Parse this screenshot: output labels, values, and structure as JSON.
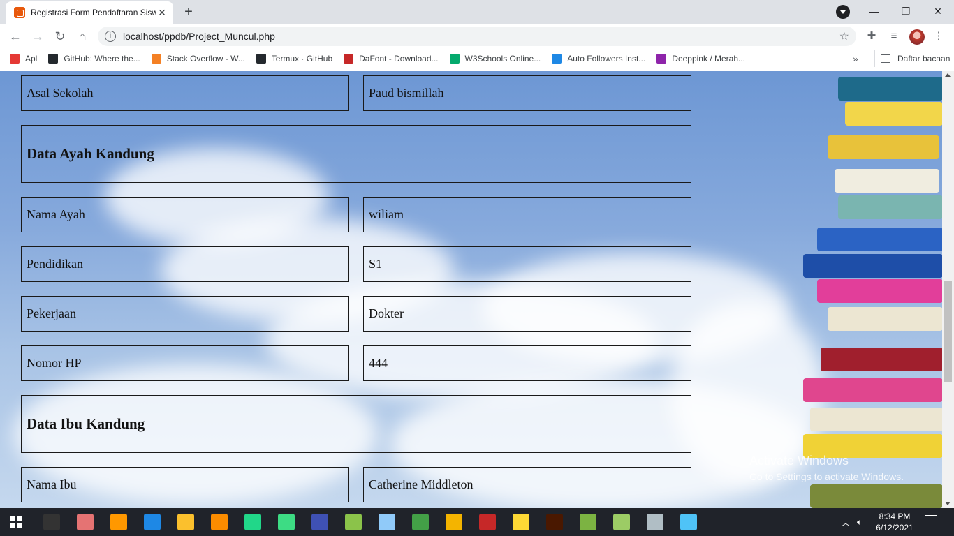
{
  "browser": {
    "tab_title": "Registrasi Form Pendaftaran Siswa",
    "tab_close": "✕",
    "new_tab": "+",
    "url": "localhost/ppdb/Project_Muncul.php",
    "window_controls": {
      "minimize": "—",
      "maximize": "❐",
      "close": "✕"
    },
    "bookmarks": [
      {
        "label": "Apl",
        "icon": "apps-grid-icon",
        "color": "#e53935"
      },
      {
        "label": "GitHub: Where the...",
        "icon": "github-icon",
        "color": "#24292e"
      },
      {
        "label": "Stack Overflow - W...",
        "icon": "stackoverflow-icon",
        "color": "#f48024"
      },
      {
        "label": "Termux · GitHub",
        "icon": "github-icon",
        "color": "#24292e"
      },
      {
        "label": "DaFont - Download...",
        "icon": "dafont-icon",
        "color": "#c62828"
      },
      {
        "label": "W3Schools Online...",
        "icon": "w3schools-icon",
        "color": "#04aa6d"
      },
      {
        "label": "Auto Followers Inst...",
        "icon": "cube-icon",
        "color": "#1e88e5"
      },
      {
        "label": "Deeppink / Merah...",
        "icon": "colorbars-icon",
        "color": "#8e24aa"
      }
    ],
    "bookmarks_more": "»",
    "reading_list": "Daftar bacaan"
  },
  "form": {
    "asal_sekolah": {
      "label": "Asal Sekolah",
      "value": "Paud bismillah"
    },
    "ayah_heading": "Data Ayah Kandung",
    "ayah": [
      {
        "label": "Nama Ayah",
        "value": "wiliam"
      },
      {
        "label": "Pendidikan",
        "value": "S1"
      },
      {
        "label": "Pekerjaan",
        "value": "Dokter"
      },
      {
        "label": "Nomor HP",
        "value": "444"
      }
    ],
    "ibu_heading": "Data Ibu Kandung",
    "ibu": [
      {
        "label": "Nama Ibu",
        "value": "Catherine Middleton"
      }
    ]
  },
  "watermark": {
    "title": "Activate Windows",
    "subtitle": "Go to Settings to activate Windows."
  },
  "taskbar": {
    "time": "8:34 PM",
    "date": "6/12/2021",
    "apps": [
      {
        "name": "terminal-icon",
        "color": "#333"
      },
      {
        "name": "paint-icon",
        "color": "#e57373"
      },
      {
        "name": "sublime-icon",
        "color": "#ff9800"
      },
      {
        "name": "vscode-icon",
        "color": "#1e88e5"
      },
      {
        "name": "file-explorer-icon",
        "color": "#fbc02d"
      },
      {
        "name": "xampp-icon",
        "color": "#fb8c00"
      },
      {
        "name": "pycharm-icon",
        "color": "#21d789"
      },
      {
        "name": "android-studio-icon",
        "color": "#3ddc84"
      },
      {
        "name": "devcpp-icon",
        "color": "#3f51b5"
      },
      {
        "name": "notepad-icon",
        "color": "#8bc34a"
      },
      {
        "name": "virtualbox-icon",
        "color": "#90caf9"
      },
      {
        "name": "phone-icon",
        "color": "#43a047"
      },
      {
        "name": "chrome-icon",
        "color": "#f4b400"
      },
      {
        "name": "filezilla-icon",
        "color": "#c62828"
      },
      {
        "name": "star-app-icon",
        "color": "#fdd835"
      },
      {
        "name": "illustrator-icon",
        "color": "#4a1800"
      },
      {
        "name": "bluestacks-icon",
        "color": "#7cb342"
      },
      {
        "name": "android-box-icon",
        "color": "#9ccc65"
      },
      {
        "name": "notes-icon",
        "color": "#b0bec5"
      },
      {
        "name": "photos-icon",
        "color": "#4fc3f7"
      }
    ]
  }
}
